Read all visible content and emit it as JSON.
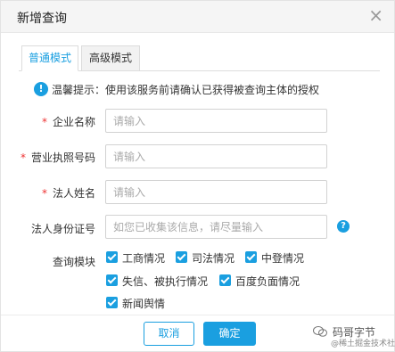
{
  "dialog": {
    "title": "新增查询",
    "close_glyph": "×"
  },
  "tabs": [
    {
      "label": "普通模式",
      "active": true
    },
    {
      "label": "高级模式",
      "active": false
    }
  ],
  "tip": {
    "icon": "!",
    "text": "温馨提示：使用该服务前请确认已获得被查询主体的授权"
  },
  "form": {
    "company": {
      "label": "企业名称",
      "required_mark": "*",
      "placeholder": "请输入"
    },
    "license": {
      "label": "营业执照号码",
      "required_mark": "*",
      "placeholder": "请输入"
    },
    "legal": {
      "label": "法人姓名",
      "required_mark": "*",
      "placeholder": "请输入"
    },
    "idcard": {
      "label": "法人身份证号",
      "placeholder": "如您已收集该信息，请尽量输入",
      "help_glyph": "?"
    },
    "modules_label": "查询模块",
    "modules": [
      {
        "label": "工商情况",
        "checked": true
      },
      {
        "label": "司法情况",
        "checked": true
      },
      {
        "label": "中登情况",
        "checked": true
      },
      {
        "label": "失信、被执行情况",
        "checked": true
      },
      {
        "label": "百度负面情况",
        "checked": true
      },
      {
        "label": "新闻舆情",
        "checked": true
      }
    ]
  },
  "buttons": {
    "cancel": "取消",
    "ok": "确定"
  },
  "watermark": {
    "name": "码哥字节",
    "sub": "@稀土掘金技术社区"
  },
  "colors": {
    "accent": "#1a9fe0",
    "required": "#ee3333"
  }
}
